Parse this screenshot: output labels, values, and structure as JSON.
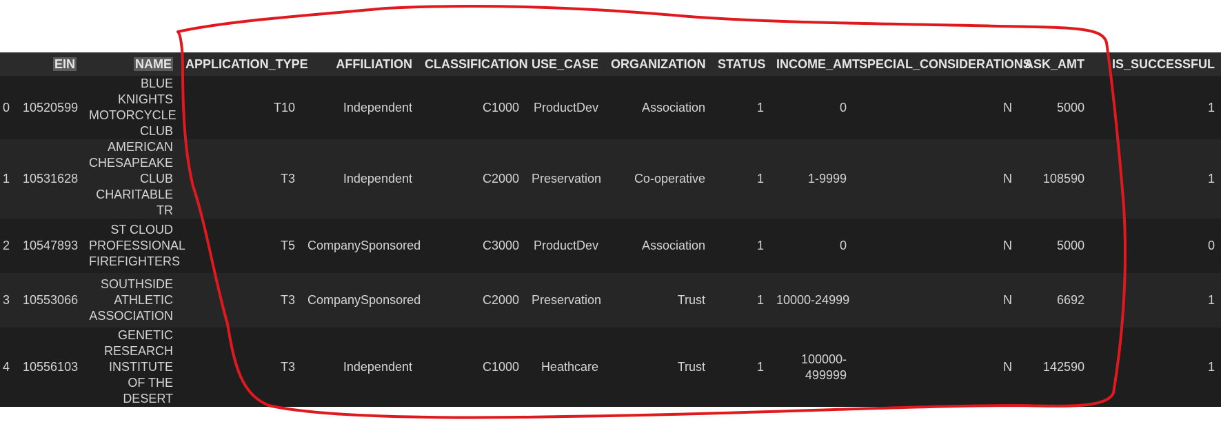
{
  "table": {
    "columns": [
      "",
      "EIN",
      "NAME",
      "APPLICATION_TYPE",
      "AFFILIATION",
      "CLASSIFICATION",
      "USE_CASE",
      "ORGANIZATION",
      "STATUS",
      "INCOME_AMT",
      "SPECIAL_CONSIDERATIONS",
      "ASK_AMT",
      "IS_SUCCESSFUL"
    ],
    "rows": [
      {
        "idx": "0",
        "ein": "10520599",
        "name": "BLUE KNIGHTS MOTORCYCLE CLUB",
        "application_type": "T10",
        "affiliation": "Independent",
        "classification": "C1000",
        "use_case": "ProductDev",
        "organization": "Association",
        "status": "1",
        "income_amt": "0",
        "special_considerations": "N",
        "ask_amt": "5000",
        "is_successful": "1"
      },
      {
        "idx": "1",
        "ein": "10531628",
        "name": "AMERICAN CHESAPEAKE CLUB CHARITABLE TR",
        "application_type": "T3",
        "affiliation": "Independent",
        "classification": "C2000",
        "use_case": "Preservation",
        "organization": "Co-operative",
        "status": "1",
        "income_amt": "1-9999",
        "special_considerations": "N",
        "ask_amt": "108590",
        "is_successful": "1"
      },
      {
        "idx": "2",
        "ein": "10547893",
        "name": "ST CLOUD PROFESSIONAL FIREFIGHTERS",
        "application_type": "T5",
        "affiliation": "CompanySponsored",
        "classification": "C3000",
        "use_case": "ProductDev",
        "organization": "Association",
        "status": "1",
        "income_amt": "0",
        "special_considerations": "N",
        "ask_amt": "5000",
        "is_successful": "0"
      },
      {
        "idx": "3",
        "ein": "10553066",
        "name": "SOUTHSIDE ATHLETIC ASSOCIATION",
        "application_type": "T3",
        "affiliation": "CompanySponsored",
        "classification": "C2000",
        "use_case": "Preservation",
        "organization": "Trust",
        "status": "1",
        "income_amt": "10000-24999",
        "special_considerations": "N",
        "ask_amt": "6692",
        "is_successful": "1"
      },
      {
        "idx": "4",
        "ein": "10556103",
        "name": "GENETIC RESEARCH INSTITUTE OF THE DESERT",
        "application_type": "T3",
        "affiliation": "Independent",
        "classification": "C1000",
        "use_case": "Heathcare",
        "organization": "Trust",
        "status": "1",
        "income_amt": "100000-499999",
        "special_considerations": "N",
        "ask_amt": "142590",
        "is_successful": "1"
      }
    ]
  },
  "colors": {
    "table_bg": "#1e1e1e",
    "row_alt_bg": "#262626",
    "header_bg": "#2b2b2b",
    "header_highlight": "#5a5a5a",
    "text": "#d4d4d4",
    "annotation_stroke": "#e0191e"
  }
}
